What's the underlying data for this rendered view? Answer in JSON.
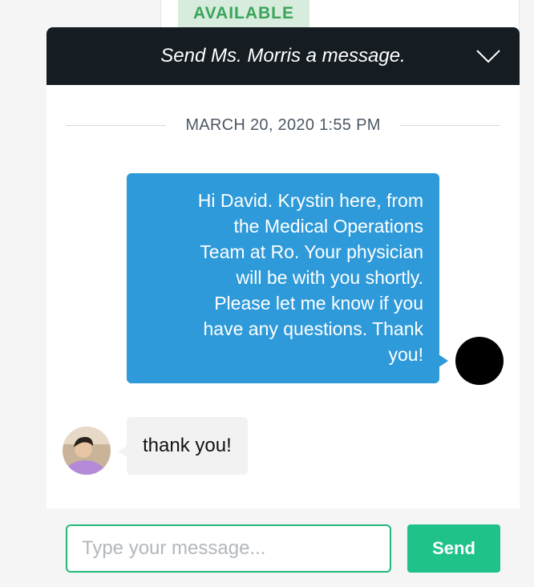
{
  "status_badge": {
    "label": "AVAILABLE"
  },
  "chat": {
    "title": "Send Ms. Morris a message.",
    "timestamp": "MARCH 20, 2020 1:55 PM",
    "messages": [
      {
        "sender": "agent",
        "text_lines": [
          "Hi David. Krystin here, from",
          "the Medical Operations",
          "Team at Ro. Your physician",
          "will be with you shortly.",
          "Please let me know if you",
          "have any questions. Thank",
          "you!"
        ]
      },
      {
        "sender": "user",
        "text": "thank you!"
      }
    ]
  },
  "composer": {
    "placeholder": "Type your message...",
    "value": "",
    "send_label": "Send"
  },
  "colors": {
    "header_bg": "#151c22",
    "outgoing_bubble": "#2e9ad9",
    "incoming_bubble": "#f2f2f2",
    "accent_green": "#1fc38a",
    "badge_bg": "#d7ecdc",
    "badge_text": "#3aa45b"
  },
  "icons": {
    "collapse": "chevron-down-icon"
  }
}
